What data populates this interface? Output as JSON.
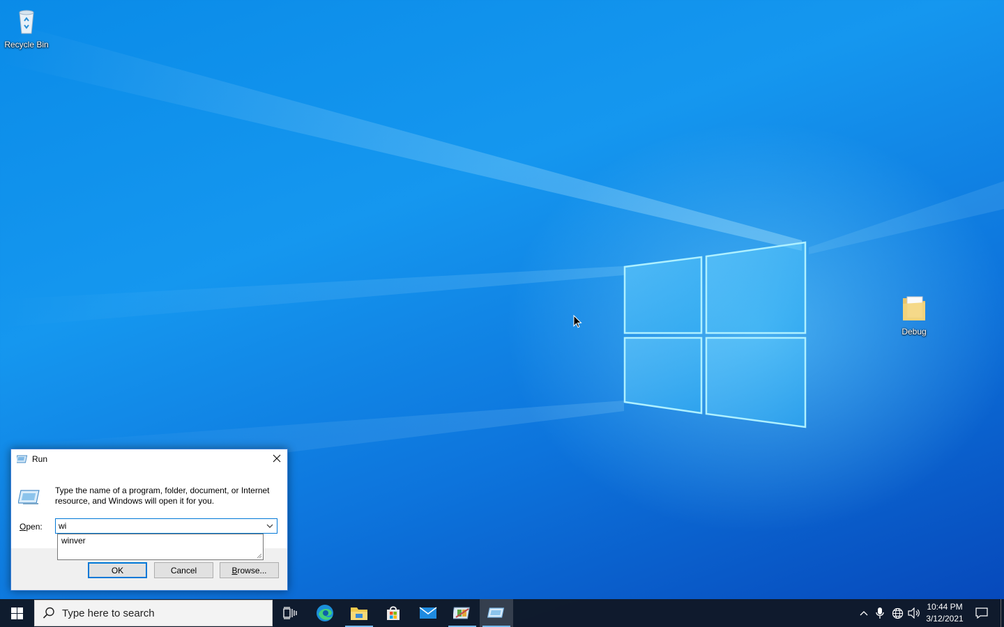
{
  "desktop": {
    "icons": [
      {
        "label": "Recycle Bin"
      },
      {
        "label": "Debug"
      }
    ]
  },
  "run_dialog": {
    "title": "Run",
    "description": "Type the name of a program, folder, document, or Internet resource, and Windows will open it for you.",
    "open_label_prefix": "",
    "open_label_underlined": "O",
    "open_label_rest": "pen:",
    "input_value": "wi",
    "suggestions": [
      "winver"
    ],
    "ok_label": "OK",
    "cancel_label": "Cancel",
    "browse_label_underlined": "B",
    "browse_label_rest": "rowse..."
  },
  "taskbar": {
    "search_placeholder": "Type here to search",
    "apps": [
      {
        "name": "task-view"
      },
      {
        "name": "edge"
      },
      {
        "name": "file-explorer"
      },
      {
        "name": "microsoft-store"
      },
      {
        "name": "mail"
      },
      {
        "name": "control-panel"
      },
      {
        "name": "run"
      }
    ],
    "clock_time": "10:44 PM",
    "clock_date": "3/12/2021"
  },
  "colors": {
    "accent": "#0078d7",
    "taskbar": "#101826",
    "desktop_blue": "#0a8be8"
  }
}
